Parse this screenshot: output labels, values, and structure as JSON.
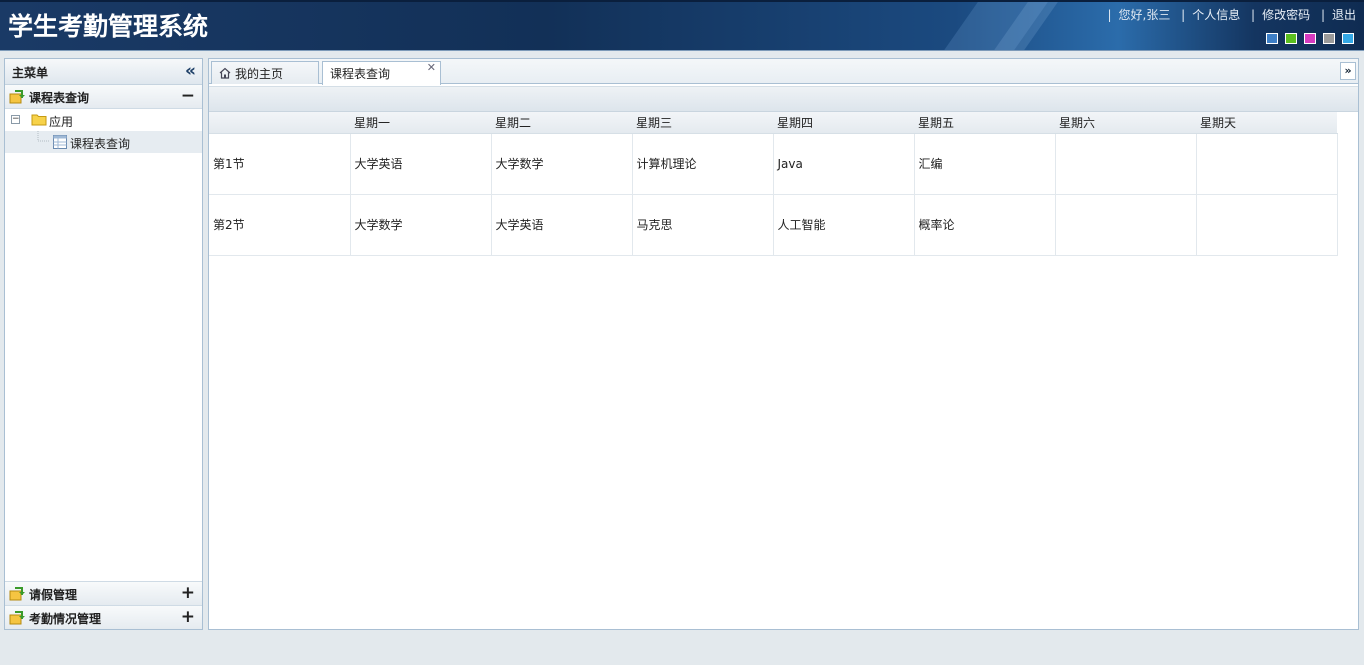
{
  "header": {
    "title": "学生考勤管理系统",
    "greeting": "您好,张三",
    "links": [
      "个人信息",
      "修改密码",
      "退出"
    ],
    "theme_colors": [
      "#3d7fc7",
      "#5bbf1f",
      "#d63bc0",
      "#9a9a9a",
      "#33a8e6"
    ]
  },
  "sidebar": {
    "title": "主菜单",
    "sections": [
      {
        "label": "课程表查询",
        "toggle": "−",
        "expanded": true
      },
      {
        "label": "请假管理",
        "toggle": "+",
        "expanded": false
      },
      {
        "label": "考勤情况管理",
        "toggle": "+",
        "expanded": false
      }
    ],
    "tree": {
      "folder": "应用",
      "leaf": "课程表查询"
    }
  },
  "tabs": [
    {
      "label": "我的主页",
      "icon": "home-icon",
      "closable": false
    },
    {
      "label": "课程表查询",
      "closable": true,
      "active": true
    }
  ],
  "schedule": {
    "headers": [
      "",
      "星期一",
      "星期二",
      "星期三",
      "星期四",
      "星期五",
      "星期六",
      "星期天"
    ],
    "rows": [
      [
        "第1节",
        "大学英语",
        "大学数学",
        "计算机理论",
        "Java",
        "汇编",
        "",
        ""
      ],
      [
        "第2节",
        "大学数学",
        "大学英语",
        "马克思",
        "人工智能",
        "概率论",
        "",
        ""
      ]
    ]
  }
}
